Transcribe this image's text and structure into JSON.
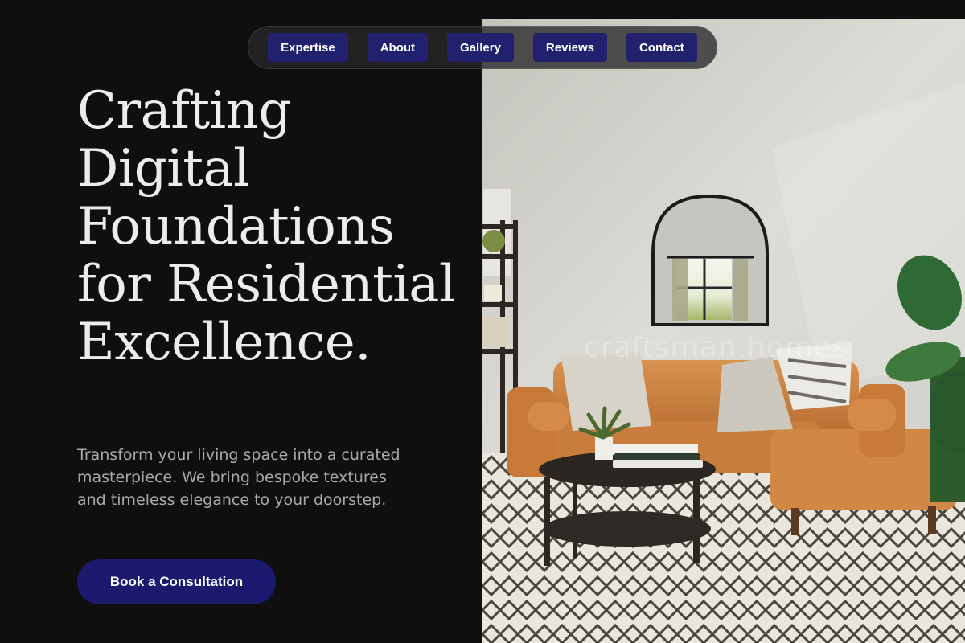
{
  "nav": {
    "items": [
      {
        "label": "Expertise"
      },
      {
        "label": "About"
      },
      {
        "label": "Gallery"
      },
      {
        "label": "Reviews"
      },
      {
        "label": "Contact"
      }
    ]
  },
  "hero": {
    "title": "Crafting Digital Foundations for Residential Excellence.",
    "subtitle": "Transform your living space into a curated masterpiece. We bring bespoke textures and timeless elegance to your doorstep.",
    "cta_label": "Book a Consultation",
    "image_watermark": "craftsman.homes"
  },
  "colors": {
    "background": "#0f0f10",
    "nav_button": "#23206d",
    "cta": "#1c1a6e",
    "title": "#ececec",
    "subtitle": "#a8a8ad"
  }
}
